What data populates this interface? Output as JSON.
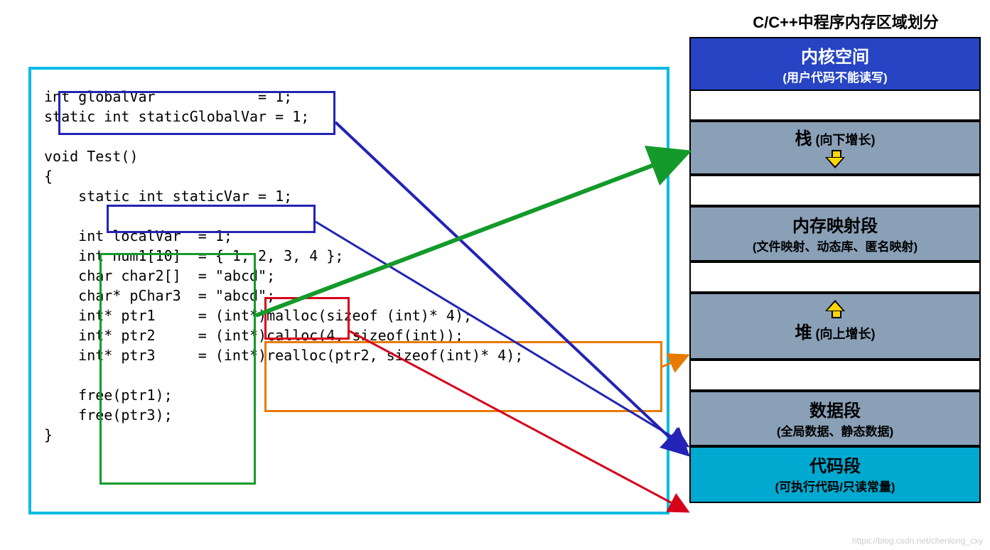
{
  "diagram_title": "C/C++中程序内存区域划分",
  "code_text": "int globalVar            = 1;\nstatic int staticGlobalVar = 1;\n\nvoid Test()\n{\n    static int staticVar = 1;\n\n    int localVar  = 1;\n    int num1[10]  = { 1, 2, 3, 4 };\n    char char2[]  = \"abcd\";\n    char* pChar3  = \"abcd\";\n    int* ptr1     = (int*)malloc(sizeof (int)* 4);\n    int* ptr2     = (int*)calloc(4, sizeof(int));\n    int* ptr3     = (int*)realloc(ptr2, sizeof(int)* 4);\n    \n    free(ptr1);\n    free(ptr3);\n}",
  "memory_regions": {
    "kernel_title": "内核空间",
    "kernel_sub": "(用户代码不能读写)",
    "stack_title": "栈",
    "stack_sub": " (向下增长)",
    "mmap_title": "内存映射段",
    "mmap_sub": "(文件映射、动态库、匿名映射)",
    "heap_title": "堆",
    "heap_sub": " (向上增长)",
    "data_title": "数据段",
    "data_sub": "(全局数据、静态数据)",
    "code_title": "代码段",
    "code_sub": "(可执行代码/只读常量)"
  },
  "arrows": [
    {
      "from": "global/static vars (blue box)",
      "to": "数据段",
      "color": "#2323b5"
    },
    {
      "from": "staticVar (blue box)",
      "to": "数据段",
      "color": "#2323b5"
    },
    {
      "from": "local vars (green box)",
      "to": "栈",
      "color": "#139a2a"
    },
    {
      "from": "\"abcd\" literals (red box)",
      "to": "代码段",
      "color": "#d6001a"
    },
    {
      "from": "malloc/calloc/realloc (orange box)",
      "to": "堆",
      "color": "#e77a00"
    }
  ],
  "watermark": "https://blog.csdn.net/chenlong_cxy"
}
